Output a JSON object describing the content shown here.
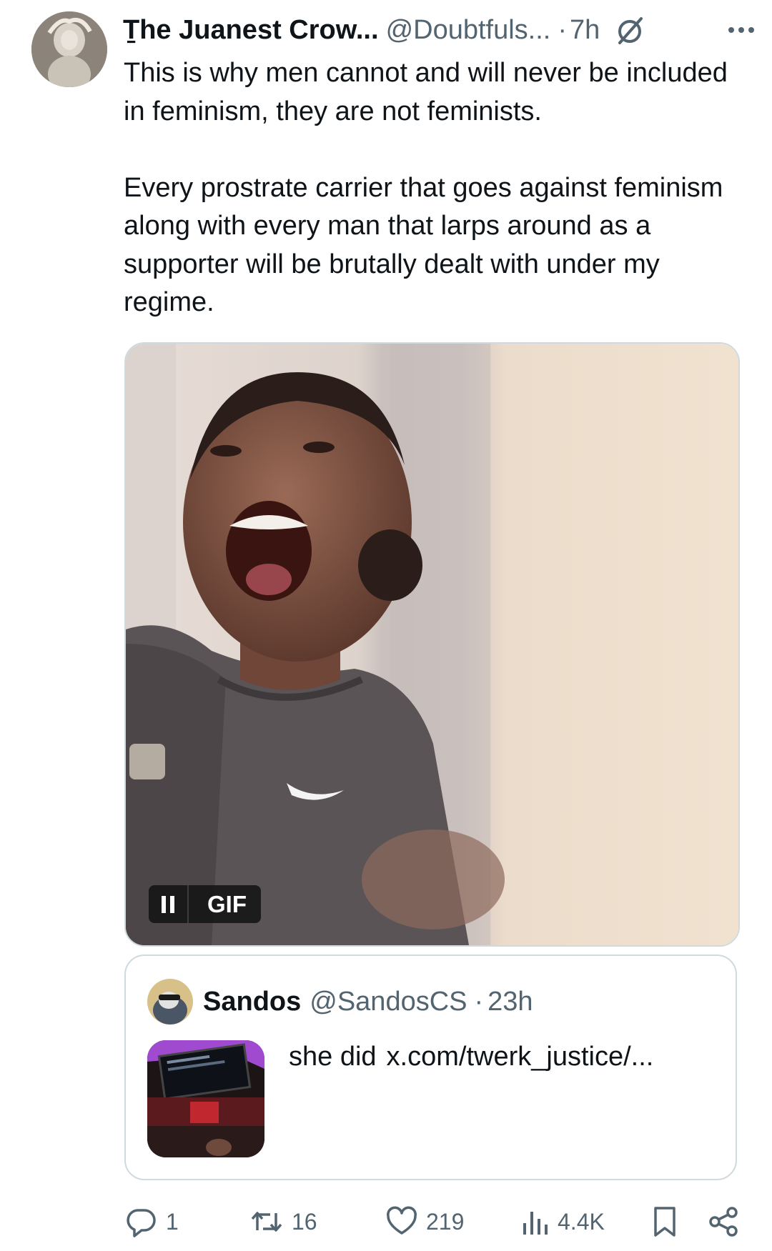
{
  "tweet": {
    "author_name": "Ṯhe Juanest Crow...",
    "author_handle": "@Doubtfuls...",
    "dot": "·",
    "time": "7h",
    "paragraphs": [
      "This is why men cannot and will never be included in feminism, they are not feminists.",
      "Every prostrate carrier that goes against feminism along with every man that larps around as a supporter will be brutally dealt with under my regime."
    ],
    "media": {
      "gif_label": "GIF",
      "pause_icon": "pause-icon"
    }
  },
  "quote": {
    "author_name": "Sandos",
    "author_handle": "@SandosCS",
    "dot": "·",
    "time": "23h",
    "text": "she did",
    "link": "x.com/twerk_justice/..."
  },
  "actions": {
    "replies": "1",
    "reposts": "16",
    "likes": "219",
    "views": "4.4K"
  },
  "colors": {
    "text": "#0f1419",
    "secondary": "#536471",
    "border": "#cfd9de"
  }
}
